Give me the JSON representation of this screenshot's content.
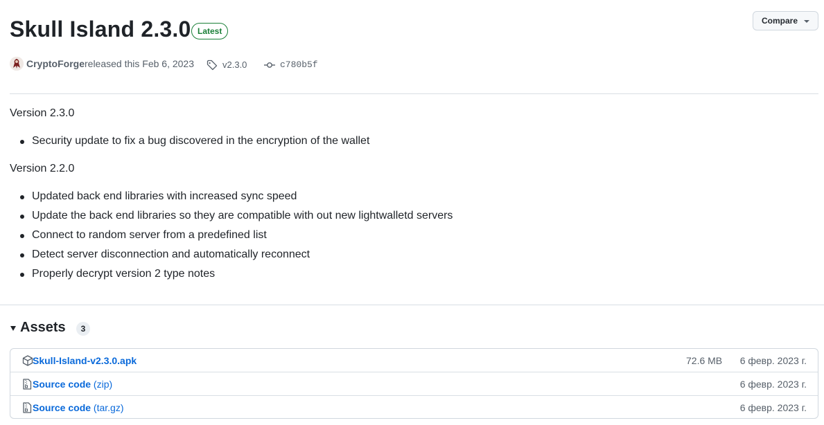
{
  "release": {
    "title": "Skull Island 2.3.0",
    "badge": "Latest",
    "compare_label": "Compare",
    "author": "CryptoForge",
    "released_text": "released this Feb 6, 2023",
    "tag": "v2.3.0",
    "commit": "c780b5f"
  },
  "notes": {
    "sections": [
      {
        "heading": "Version 2.3.0",
        "items": [
          "Security update to fix a bug discovered in the encryption of the wallet"
        ]
      },
      {
        "heading": "Version 2.2.0",
        "items": [
          "Updated back end libraries with increased sync speed",
          "Update the back end libraries so they are compatible with out new lightwalletd servers",
          "Connect to random server from a predefined list",
          "Detect server disconnection and automatically reconnect",
          "Properly decrypt version 2 type notes"
        ]
      }
    ]
  },
  "assets": {
    "title": "Assets",
    "count": "3",
    "items": [
      {
        "name": "Skull-Island-v2.3.0.apk",
        "suffix": "",
        "size": "72.6 MB",
        "date": "6 февр. 2023 г.",
        "icon": "package-icon"
      },
      {
        "name": "Source code",
        "suffix": " (zip)",
        "size": "",
        "date": "6 февр. 2023 г.",
        "icon": "file-zip-icon"
      },
      {
        "name": "Source code",
        "suffix": " (tar.gz)",
        "size": "",
        "date": "6 февр. 2023 г.",
        "icon": "file-zip-icon"
      }
    ]
  },
  "colors": {
    "accent_link": "#0969da",
    "badge_green": "#1a7f37",
    "muted_text": "#57606a"
  }
}
